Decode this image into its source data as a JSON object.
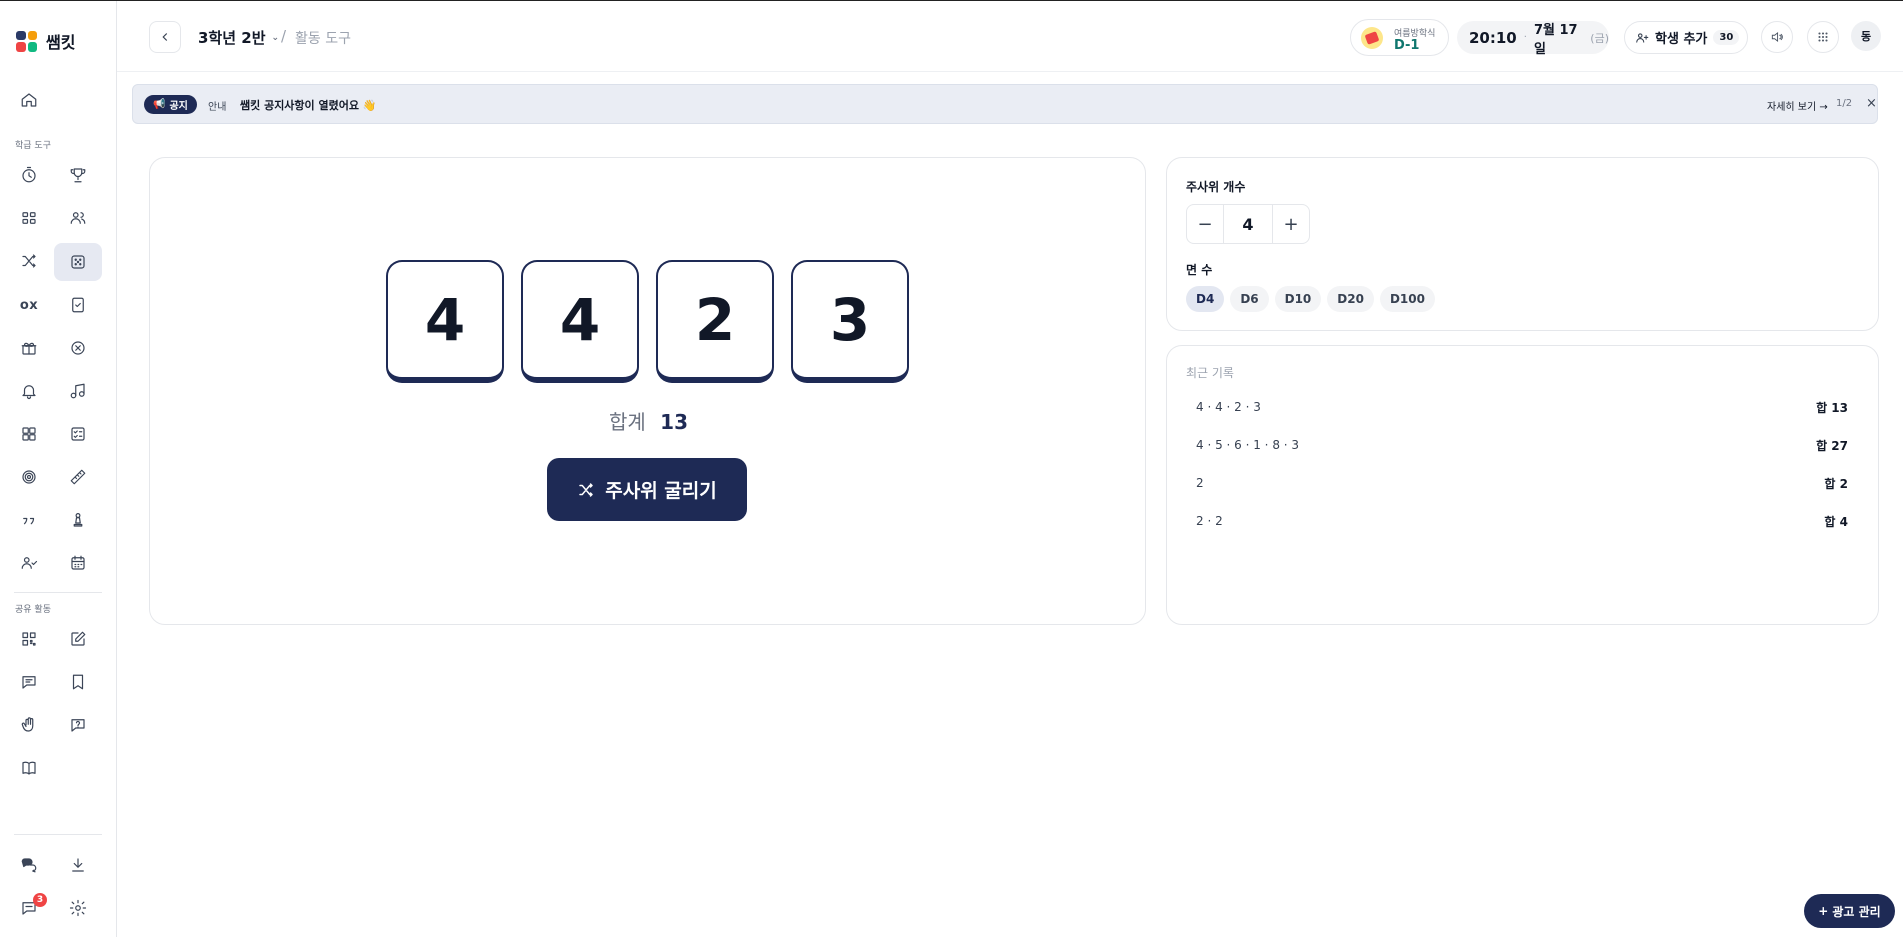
{
  "app": {
    "name": "쌤킷"
  },
  "sidebar": {
    "section_learning": "학급 도구",
    "section_shared": "공유 활동",
    "chat_badge": "3",
    "icon_text": "ox"
  },
  "header": {
    "class_name": "3학년 2반",
    "separator": "/",
    "page_title": "활동 도구",
    "event": {
      "label": "여름방학식",
      "dday": "D-1"
    },
    "time": "20:10",
    "date": "7월 17일",
    "weekday": "(금)",
    "add_student_label": "학생 추가",
    "student_count": "30",
    "avatar_initial": "동"
  },
  "notice": {
    "tag": "공지",
    "type": "안내",
    "text": "쌤킷 공지사항이 열렸어요 👋",
    "more": "자세히 보기 →",
    "page": "1/2",
    "close": "×"
  },
  "dice": {
    "values": [
      "4",
      "4",
      "2",
      "3"
    ],
    "sum_label": "합계",
    "sum_value": "13",
    "roll_label": "주사위 굴리기"
  },
  "settings": {
    "count_label": "주사위 개수",
    "count_value": "4",
    "minus": "−",
    "plus": "+",
    "sides_label": "면 수",
    "sides": [
      "D4",
      "D6",
      "D10",
      "D20",
      "D100"
    ],
    "selected_side": "D4"
  },
  "history": {
    "title": "최근 기록",
    "rows": [
      {
        "dice": "4 · 4 · 2 · 3",
        "sum": "합 13"
      },
      {
        "dice": "4 · 5 · 6 · 1 · 8 · 3",
        "sum": "합 27"
      },
      {
        "dice": "2",
        "sum": "합 2"
      },
      {
        "dice": "2 · 2",
        "sum": "합 4"
      }
    ]
  },
  "ad_button": {
    "label": "광고 관리",
    "icon": "+"
  },
  "colors": {
    "primary": "#1e2a55",
    "notice_bg": "#eaedf4",
    "badge": "#ef4444"
  }
}
